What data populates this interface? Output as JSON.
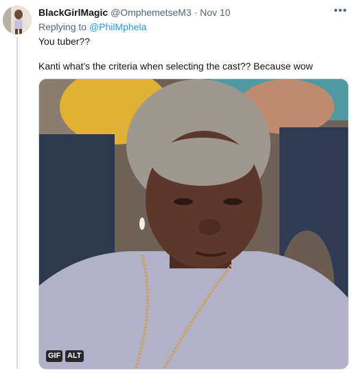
{
  "tweet": {
    "display_name": "BlackGirlMagic",
    "handle": "@OmphemetseM3",
    "separator": "·",
    "date": "Nov 10",
    "replying_prefix": "Replying to",
    "replying_to": "@PhilMphela",
    "text_line1": "You tuber??",
    "text_line2": "Kanti what's the criteria when selecting the cast?? Because wow",
    "more_icon": "more-horizontal-icon"
  },
  "media": {
    "gif_badge": "GIF",
    "alt_badge": "ALT"
  },
  "colors": {
    "link": "#1d9bf0",
    "secondary_text": "#536471",
    "thread_line": "#cfd9de"
  }
}
